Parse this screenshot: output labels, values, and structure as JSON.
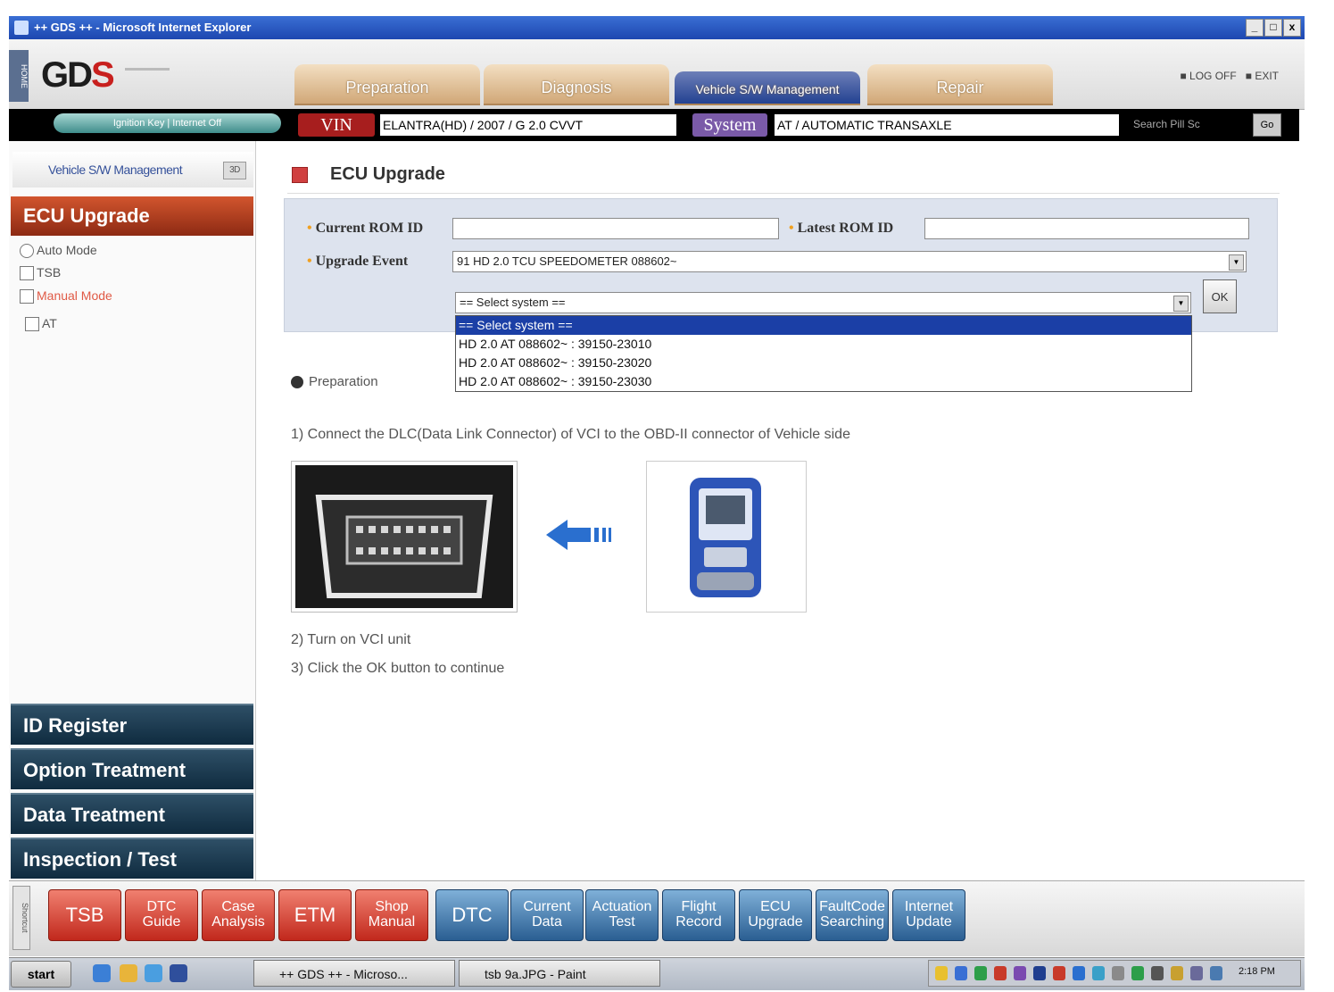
{
  "window": {
    "title": "++ GDS ++ - Microsoft Internet Explorer",
    "controls": [
      "_",
      "□",
      "x"
    ]
  },
  "header": {
    "home_label": "HOME",
    "logo_text": "GD",
    "logo_accent": "S",
    "tabs": [
      {
        "label": "Preparation",
        "active": false
      },
      {
        "label": "Diagnosis",
        "active": false
      },
      {
        "label": "Vehicle S/W Management",
        "active": true
      },
      {
        "label": "Repair",
        "active": false
      }
    ],
    "logoff": "LOG OFF",
    "exit": "EXIT"
  },
  "infobar": {
    "keyset": "Ignition Key | Internet Off",
    "vin_label": "VIN",
    "vin_value": "ELANTRA(HD) / 2007 / G 2.0 CVVT",
    "system_label": "System",
    "system_value": "AT / AUTOMATIC TRANSAXLE",
    "search_label": "Search  Pill Sc",
    "search_button": "Go"
  },
  "sidebar": {
    "section_title": "Vehicle S/W Management",
    "section_button": "3D",
    "ecu_header": "ECU Upgrade",
    "tree": [
      {
        "label": "Auto Mode",
        "highlight": false
      },
      {
        "label": "TSB",
        "highlight": false
      },
      {
        "label": "Manual Mode",
        "highlight": true
      },
      {
        "label": "AT",
        "highlight": false
      }
    ],
    "groups": [
      "ID Register",
      "Option Treatment",
      "Data Treatment",
      "Inspection / Test"
    ]
  },
  "main": {
    "title": "ECU Upgrade",
    "form": {
      "current_rom_label": "Current ROM ID",
      "current_rom_value": "",
      "latest_rom_label": "Latest ROM ID",
      "latest_rom_value": "",
      "upgrade_event_label": "Upgrade Event",
      "upgrade_event_value": "91 HD 2.0 TCU SPEEDOMETER 088602~",
      "system_select_value": "== Select system ==",
      "ok_label": "OK"
    },
    "dropdown_options": [
      {
        "label": "== Select system ==",
        "selected": true
      },
      {
        "label": "HD 2.0 AT 088602~ : 39150-23010",
        "selected": false
      },
      {
        "label": "HD 2.0 AT 088602~ : 39150-23020",
        "selected": false
      },
      {
        "label": "HD 2.0 AT 088602~ : 39150-23030",
        "selected": false
      }
    ],
    "preparation_label": "Preparation",
    "steps": [
      "1) Connect the DLC(Data Link Connector) of VCI to the OBD-II connector of Vehicle side",
      "2) Turn on VCI unit",
      "3) Click the OK button to continue"
    ]
  },
  "toolbar": {
    "shortcut_label": "Shortcut",
    "red_buttons": [
      "TSB",
      "DTC Guide",
      "Case Analysis",
      "ETM",
      "Shop Manual"
    ],
    "blue_buttons": [
      "DTC",
      "Current Data",
      "Actuation Test",
      "Flight Record",
      "ECU Upgrade",
      "FaultCode Searching",
      "Internet Update"
    ]
  },
  "taskbar": {
    "start": "start",
    "tasks": [
      "++ GDS ++ - Microso...",
      "tsb 9a.JPG - Paint"
    ],
    "clock": "2:18 PM"
  },
  "colors": {
    "accent_blue": "#1f3e8f",
    "accent_red": "#c1281c",
    "sidebar_dark": "#0f2b3f",
    "ecu_header": "#8d2a13"
  }
}
